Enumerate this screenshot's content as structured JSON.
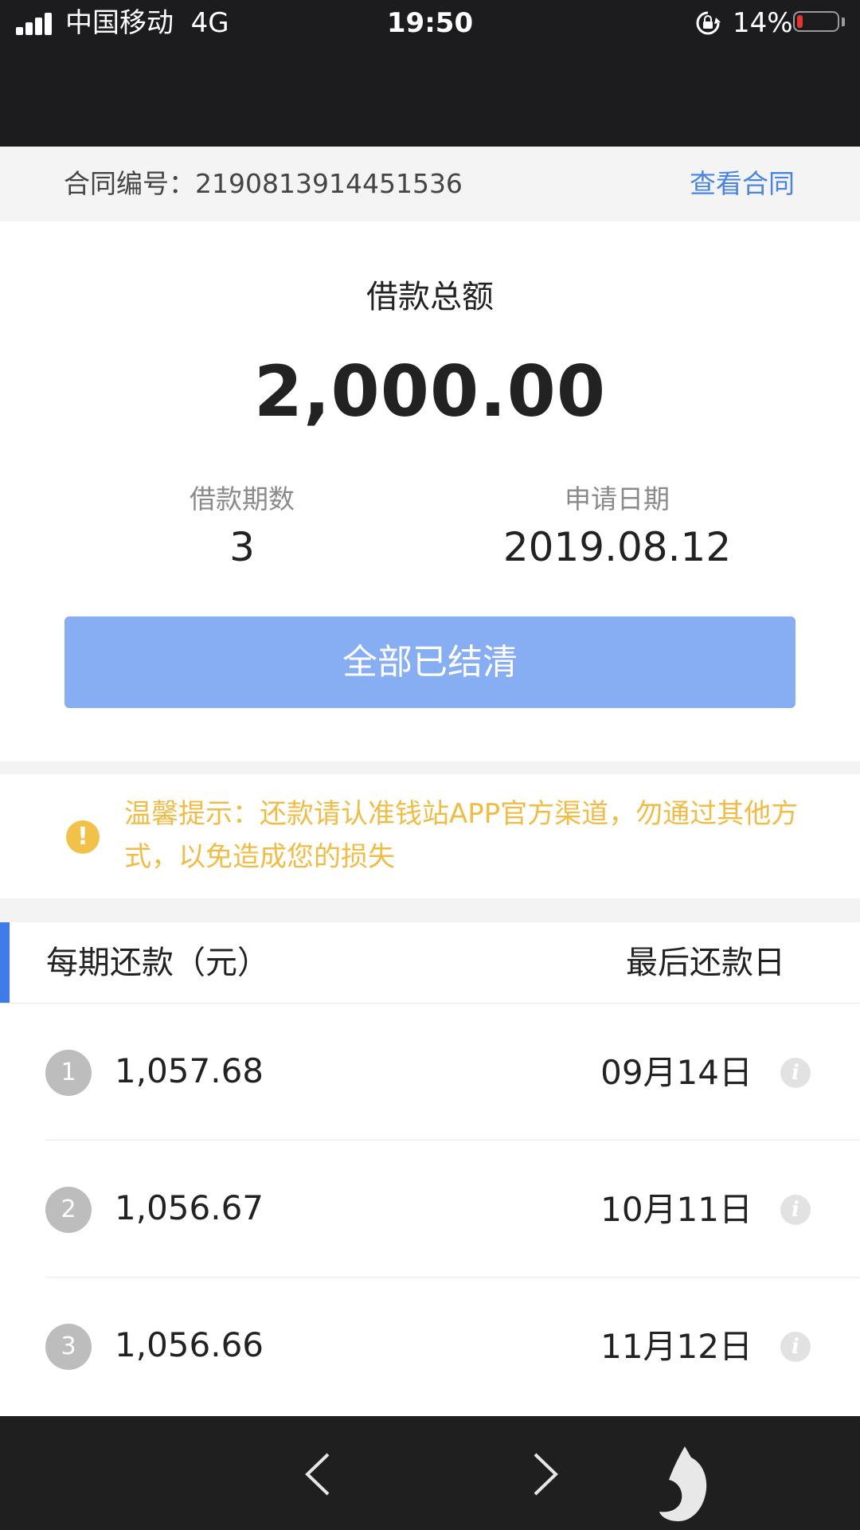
{
  "status_bar": {
    "carrier": "中国移动",
    "network": "4G",
    "time": "19:50",
    "battery_percent_label": "14%",
    "battery_level": 0.14,
    "colors": {
      "battery_low": "#e8332f"
    }
  },
  "contract": {
    "label": "合同编号：",
    "number": "2190813914451536",
    "view_link": "查看合同"
  },
  "summary": {
    "title": "借款总额",
    "amount": "2,000.00",
    "terms_label": "借款期数",
    "terms_value": "3",
    "date_label": "申请日期",
    "date_value": "2019.08.12",
    "status_button": "全部已结清"
  },
  "tip": {
    "icon": "exclamation-icon",
    "text": "温馨提示：还款请认准钱站APP官方渠道，勿通过其他方式，以免造成您的损失"
  },
  "schedule": {
    "header_left": "每期还款（元）",
    "header_right": "最后还款日",
    "rows": [
      {
        "index": "1",
        "amount": "1,057.68",
        "due": "09月14日"
      },
      {
        "index": "2",
        "amount": "1,056.67",
        "due": "10月11日"
      },
      {
        "index": "3",
        "amount": "1,056.66",
        "due": "11月12日"
      }
    ]
  },
  "colors": {
    "accent_blue": "#3f7be8",
    "link_blue": "#4a84e2",
    "button_blue": "#87adf2",
    "tip_yellow": "#f0bc45"
  }
}
